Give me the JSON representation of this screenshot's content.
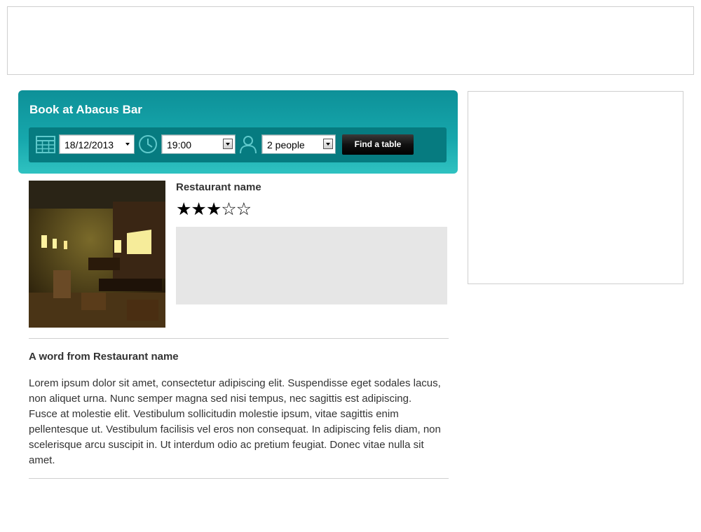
{
  "booking": {
    "title": "Book at Abacus Bar",
    "date": "18/12/2013",
    "time": "19:00",
    "people": "2 people",
    "find_button": "Find a table",
    "accent_colors": {
      "panel": "#0d9098",
      "bar": "#067b80",
      "button": "#000000"
    }
  },
  "icons": [
    "calendar-icon",
    "clock-icon",
    "person-icon"
  ],
  "restaurant": {
    "name": "Restaurant name",
    "rating": 3,
    "rating_max": 5,
    "stars": "★★★☆☆"
  },
  "about": {
    "title": "A word from Restaurant name",
    "text": "Lorem ipsum dolor sit amet, consectetur adipiscing elit. Suspendisse eget sodales lacus, non aliquet urna. Nunc semper magna sed nisi tempus, nec sagittis est adipiscing. Fusce at molestie elit. Vestibulum sollicitudin molestie ipsum, vitae sagittis enim pellentesque ut. Vestibulum facilisis vel eros non consequat. In adipiscing felis diam, non scelerisque arcu suscipit in. Ut interdum odio ac pretium feugiat. Donec vitae nulla sit amet."
  }
}
